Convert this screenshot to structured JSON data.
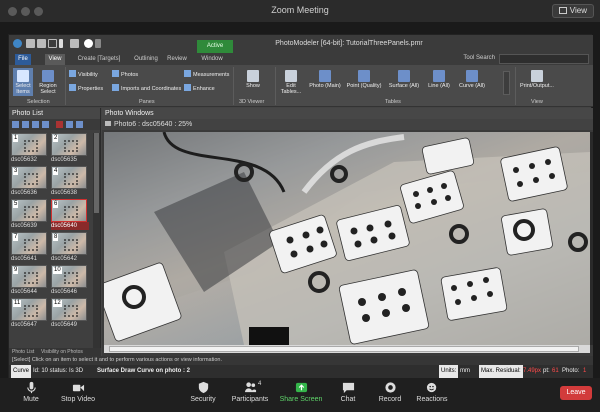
{
  "zoom": {
    "title": "Zoom Meeting",
    "view_label": "View",
    "controls": [
      {
        "label": "Mute",
        "icon": "mic-icon"
      },
      {
        "label": "Stop Video",
        "icon": "video-icon"
      },
      {
        "label": "Security",
        "icon": "shield-icon"
      },
      {
        "label": "Participants",
        "icon": "participants-icon",
        "count": "4"
      },
      {
        "label": "Share Screen",
        "icon": "share-screen-icon"
      },
      {
        "label": "Chat",
        "icon": "chat-icon"
      },
      {
        "label": "Record",
        "icon": "record-icon"
      },
      {
        "label": "Reactions",
        "icon": "reactions-icon"
      }
    ],
    "leave_label": "Leave"
  },
  "app": {
    "title": "PhotoModeler [64-bit]: TutorialThreePanels.pmr",
    "active_context": "Active",
    "tabs": [
      "File",
      "View",
      "Create [Targets]",
      "Outlining",
      "Review",
      "Window"
    ],
    "active_tab": "View",
    "tool_search_label": "Tool Search",
    "ribbon": {
      "selection": {
        "label": "Selection",
        "buttons": [
          "Select Items",
          "Region Select"
        ]
      },
      "panes": {
        "label": "Panes",
        "items": [
          "Visibility",
          "Properties",
          "Photos",
          "Imports and Coordinates",
          "Measurements",
          "Enhance"
        ]
      },
      "viewer": {
        "label": "3D Viewer",
        "buttons": [
          "Show"
        ]
      },
      "tables": {
        "label": "Tables",
        "edit": "Edit Tables...",
        "items": [
          "Photo (Main)",
          "Point (Quality)",
          "Surface (All)",
          "Line (All)",
          "Curve (All)"
        ]
      },
      "view": {
        "label": "View",
        "buttons": [
          "Print/Output..."
        ]
      }
    },
    "photo_list": {
      "title": "Photo List",
      "thumbnails": [
        {
          "num": "1",
          "label": "dsc05632"
        },
        {
          "num": "2",
          "label": "dsc05635"
        },
        {
          "num": "3",
          "label": "dsc05636"
        },
        {
          "num": "4",
          "label": "dsc05638"
        },
        {
          "num": "5",
          "label": "dsc05639"
        },
        {
          "num": "6",
          "label": "dsc05640",
          "selected": true
        },
        {
          "num": "7",
          "label": "dsc05641"
        },
        {
          "num": "8",
          "label": "dsc05642"
        },
        {
          "num": "9",
          "label": "dsc05644"
        },
        {
          "num": "10",
          "label": "dsc05646"
        },
        {
          "num": "11",
          "label": "dsc05647"
        },
        {
          "num": "12",
          "label": "dsc05649"
        }
      ],
      "bottom_tabs": [
        "Photo List",
        "Visibility on Photos"
      ]
    },
    "photo_windows": {
      "title": "Photo Windows",
      "subtitle": "Photo6 : dsc05640 : 25%"
    },
    "hint": "[Select] Click on an item to select it and to perform various actions or view information.",
    "status": {
      "curve_label": "Curve",
      "curve_text": "Id: 10 status: Is 3D",
      "surface_text": "Surface Draw Curve on photo : 2",
      "units_label": "Units:",
      "units_value": "mm",
      "residual_label": "Max. Residual:",
      "residual_value": "7.49px",
      "pt_label": "pt:",
      "pt_value": "61",
      "photo_label": "Photo:",
      "photo_value": "1"
    }
  }
}
